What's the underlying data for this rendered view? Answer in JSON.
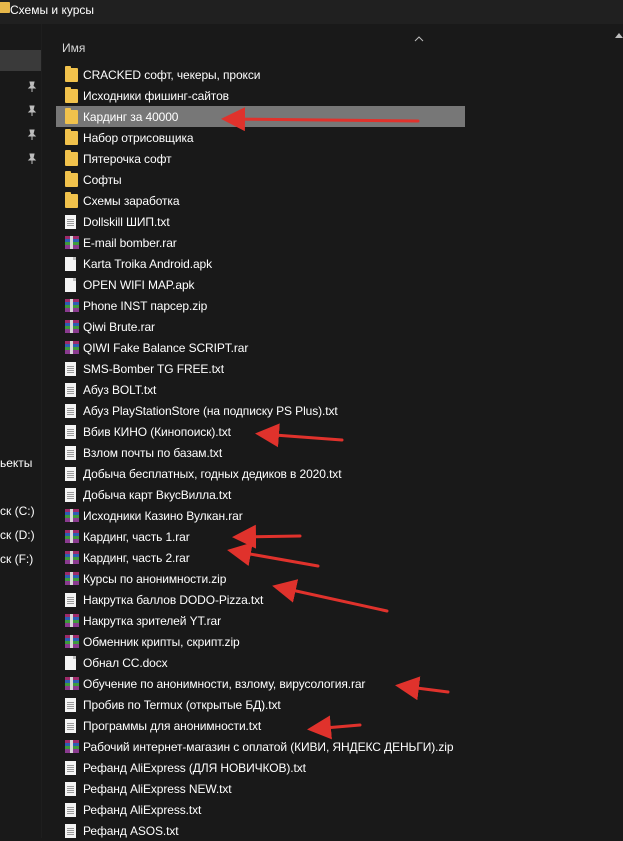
{
  "window": {
    "title": "Схемы и курсы"
  },
  "nav": {
    "items": [
      {
        "label": "ьекты"
      },
      {
        "label": "ск (C:)"
      },
      {
        "label": "ск (D:)"
      },
      {
        "label": "ск (F:)"
      }
    ]
  },
  "header": {
    "name_col": "Имя"
  },
  "colors": {
    "background": "#191919",
    "selected_row": "#777777",
    "folder": "#f1c24c",
    "arrow": "#e0322c"
  },
  "files": [
    {
      "name": "CRACKED софт, чекеры, прокси",
      "type": "folder"
    },
    {
      "name": "Исходники фишинг-сайтов",
      "type": "folder"
    },
    {
      "name": "Кардинг за 40000",
      "type": "folder",
      "selected": true
    },
    {
      "name": "Набор отрисовщика",
      "type": "folder"
    },
    {
      "name": "Пятерочка софт",
      "type": "folder"
    },
    {
      "name": "Софты",
      "type": "folder"
    },
    {
      "name": "Схемы заработка",
      "type": "folder"
    },
    {
      "name": "Dollskill ШИП.txt",
      "type": "txt"
    },
    {
      "name": "E-mail bomber.rar",
      "type": "rar"
    },
    {
      "name": "Karta Troika Android.apk",
      "type": "file"
    },
    {
      "name": "OPEN WIFI MAP.apk",
      "type": "file"
    },
    {
      "name": "Phone INST парсер.zip",
      "type": "rar"
    },
    {
      "name": "Qiwi Brute.rar",
      "type": "rar"
    },
    {
      "name": "QIWI Fake Balance SCRIPT.rar",
      "type": "rar"
    },
    {
      "name": "SMS-Bomber TG FREE.txt",
      "type": "txt"
    },
    {
      "name": "Абуз BOLT.txt",
      "type": "txt"
    },
    {
      "name": "Абуз PlayStationStore (на подписку PS Plus).txt",
      "type": "txt"
    },
    {
      "name": "Вбив КИНО (Кинопоиск).txt",
      "type": "txt"
    },
    {
      "name": "Взлом почты по базам.txt",
      "type": "txt"
    },
    {
      "name": "Добыча бесплатных, годных дедиков в 2020.txt",
      "type": "txt"
    },
    {
      "name": "Добыча карт ВкусВилла.txt",
      "type": "txt"
    },
    {
      "name": "Исходники Казино Вулкан.rar",
      "type": "rar"
    },
    {
      "name": "Кардинг, часть 1.rar",
      "type": "rar"
    },
    {
      "name": "Кардинг, часть 2.rar",
      "type": "rar"
    },
    {
      "name": "Курсы по анонимности.zip",
      "type": "rar"
    },
    {
      "name": "Накрутка баллов DODO-Pizza.txt",
      "type": "txt"
    },
    {
      "name": "Накрутка зрителей YT.rar",
      "type": "rar"
    },
    {
      "name": "Обменник крипты, скрипт.zip",
      "type": "rar"
    },
    {
      "name": "Обнал CC.docx",
      "type": "file"
    },
    {
      "name": "Обучение по анонимности, взлому, вирусология.rar",
      "type": "rar"
    },
    {
      "name": "Пробив по Termux (открытые БД).txt",
      "type": "txt"
    },
    {
      "name": "Программы для анонимности.txt",
      "type": "txt"
    },
    {
      "name": "Рабочий интернет-магазин с оплатой (КИВИ, ЯНДЕКС ДЕНЬГИ).zip",
      "type": "rar"
    },
    {
      "name": "Рефанд AliExpress (ДЛЯ НОВИЧКОВ).txt",
      "type": "txt"
    },
    {
      "name": "Рефанд AliExpress NEW.txt",
      "type": "txt"
    },
    {
      "name": "Рефанд AliExpress.txt",
      "type": "txt"
    },
    {
      "name": "Рефанд ASOS.txt",
      "type": "txt"
    }
  ]
}
